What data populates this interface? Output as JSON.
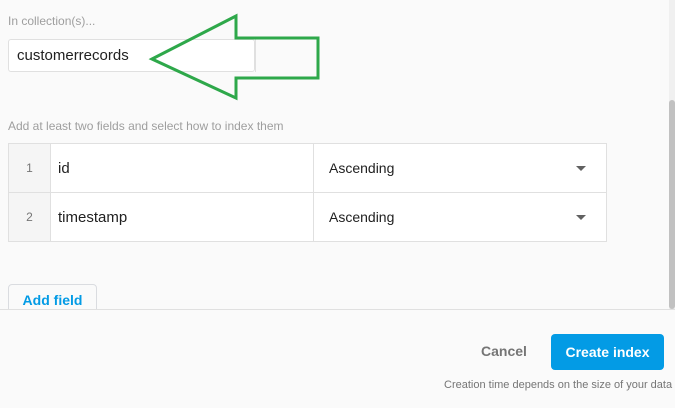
{
  "collection": {
    "label": "In collection(s)...",
    "value": "customerrecords"
  },
  "fields_section": {
    "instruction": "Add at least two fields and select how to index them",
    "rows": [
      {
        "index": "1",
        "field": "id",
        "order": "Ascending"
      },
      {
        "index": "2",
        "field": "timestamp",
        "order": "Ascending"
      }
    ],
    "add_field_label": "Add field"
  },
  "footer": {
    "cancel_label": "Cancel",
    "create_label": "Create index",
    "hint": "Creation time depends on the size of your data"
  },
  "colors": {
    "accent": "#039be5",
    "annotation_arrow": "#2ea84a"
  }
}
